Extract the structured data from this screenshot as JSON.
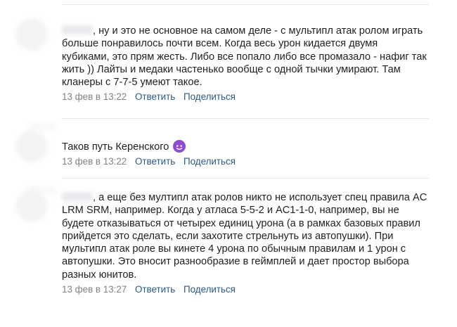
{
  "comments": [
    {
      "text": ", ну и это не основное на самом деле - с мультипл атак ролом играть больше понравилось почти всем. Когда весь урон кидается двумя кубиками, это прям жесть. Либо все попало либо все промазало - нафиг так жить )) Лайты и медаки частенько вообще с одной тычки умирают. Там кланеры с 7-7-5 умеют такое.",
      "date": "13 фев в 13:22",
      "reply": "Ответить",
      "share": "Поделиться"
    },
    {
      "text": "Таков путь Керенского",
      "emoji": "smiling-imp-emoji",
      "date": "13 фев в 13:22",
      "reply": "Ответить",
      "share": "Поделиться"
    },
    {
      "text": ", а еще без мултипл атак ролов никто не использует спец правила AC LRM SRM, например. Когда у атласа 5-5-2 и AC1-1-0, например, вы не будете отказываться от четырех единиц урона (а в рамках базовых правил прийдется это сделать, если захотите стрельнуть из автопушки). При мультипл атак роле вы кинете 4 урона по обычным правилам и 1 урон с автопушки. Это вносит разнообразие в геймплей и дает простор выбора разных юнитов.",
      "date": "13 фев в 13:27",
      "reply": "Ответить",
      "share": "Поделиться"
    }
  ],
  "colors": {
    "link": "#2a5885",
    "date": "#828282",
    "text": "#1f1f1f",
    "separator": "#e7e8ec"
  }
}
